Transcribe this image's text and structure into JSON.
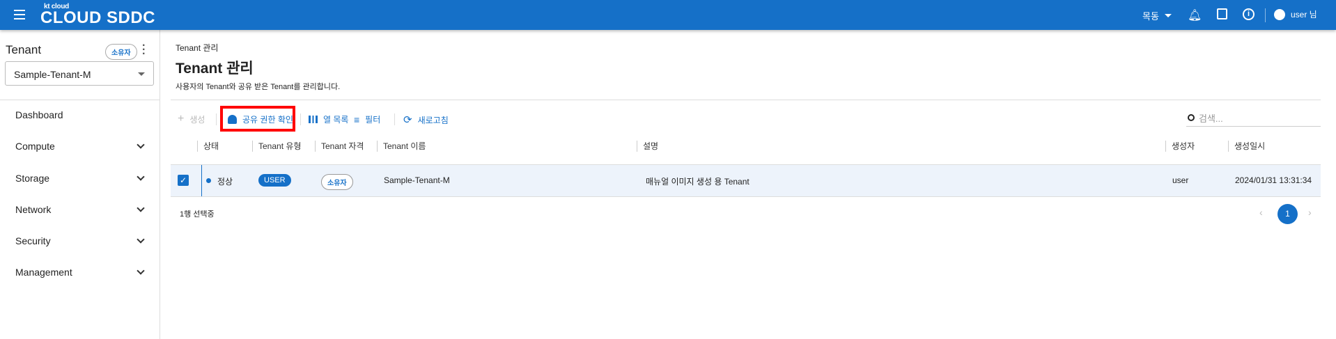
{
  "header": {
    "logo_small": "kt cloud",
    "logo": "CLOUD SDDC",
    "region": "목동",
    "user": "user 님"
  },
  "sidebar": {
    "title": "Tenant",
    "role_badge": "소유자",
    "tenant_select": "Sample-Tenant-M",
    "items": [
      {
        "label": "Dashboard"
      },
      {
        "label": "Compute"
      },
      {
        "label": "Storage"
      },
      {
        "label": "Network"
      },
      {
        "label": "Security"
      },
      {
        "label": "Management"
      }
    ]
  },
  "main": {
    "breadcrumb": "Tenant 관리",
    "title": "Tenant 관리",
    "description": "사용자의 Tenant와 공유 받은 Tenant를 관리합니다.",
    "toolbar": {
      "create": "생성",
      "share_check": "공유 권한 확인",
      "columns": "열 목록",
      "filter": "필터",
      "refresh": "새로고침",
      "search_placeholder": "검색..."
    },
    "table": {
      "headers": [
        "상태",
        "Tenant 유형",
        "Tenant 자격",
        "Tenant 이름",
        "설명",
        "생성자",
        "생성일시"
      ],
      "rows": [
        {
          "status": "정상",
          "type": "USER",
          "role": "소유자",
          "name": "Sample-Tenant-M",
          "description": "매뉴얼 이미지 생성 용 Tenant",
          "creator": "user",
          "created": "2024/01/31 13:31:34",
          "selected": true
        }
      ]
    },
    "selection_status": "1행 선택중",
    "pagination": {
      "current": "1"
    }
  },
  "colors": {
    "primary": "#1570c8",
    "highlight": "#red"
  }
}
